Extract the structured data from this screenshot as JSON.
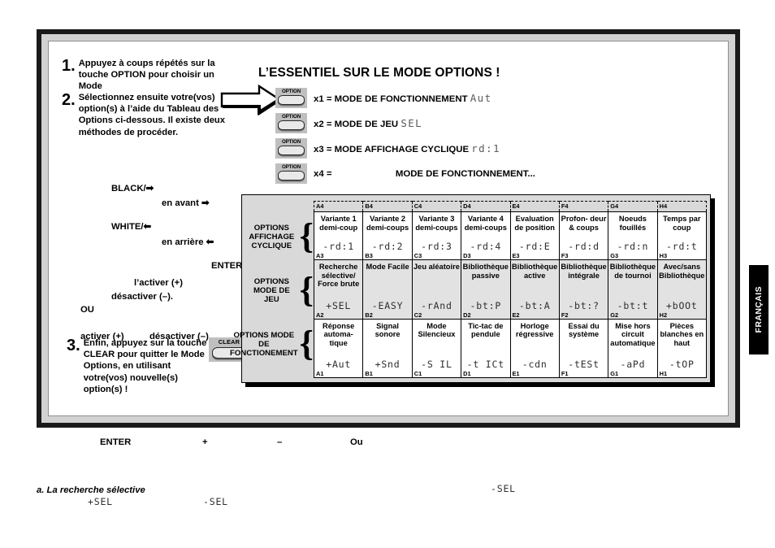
{
  "title": "L’ESSENTIEL SUR LE MODE OPTIONS !",
  "steps": [
    {
      "num": "1.",
      "text": "Appuyez à coups répétés sur la touche OPTION pour choisir un Mode"
    },
    {
      "num": "2.",
      "text": "Sélectionnez ensuite votre(vos) option(s) à l’aide du Tableau des Options ci-dessous. Il existe deux méthodes de procéder."
    },
    {
      "num": "3.",
      "text": "Enfin, appuyez sur la touche CLEAR pour quitter le Mode Options, en utilisant votre(vos) nouvelle(s) option(s) !"
    }
  ],
  "option_rows": [
    {
      "key": "OPTION",
      "count": "x1 =",
      "label": "MODE DE FONCTIONNEMENT",
      "lcd": "Aut"
    },
    {
      "key": "OPTION",
      "count": "x2 =",
      "label": "MODE DE JEU",
      "lcd": "SEL"
    },
    {
      "key": "OPTION",
      "count": "x3 =",
      "label": "MODE AFFICHAGE CYCLIQUE",
      "lcd": "rd:1"
    },
    {
      "key": "OPTION",
      "count": "x4 =",
      "label": "MODE DE FONCTIONNEMENT...",
      "lcd": ""
    }
  ],
  "nav": {
    "black": "BLACK/➡",
    "en_avant": "en avant ➡",
    "white": "WHITE/⬅",
    "en_arriere": "en arrière ⬅",
    "enter": "ENTER",
    "activer": "l’activer (+)",
    "desactiver": "désactiver (–).",
    "ou": "OU",
    "activer2": "activer (+)",
    "desactiver2": "désactiver (–)"
  },
  "clear_key": {
    "label": "CLEAR"
  },
  "table": {
    "groups": [
      "OPTIONS AFFICHAGE CYCLIQUE",
      "OPTIONS MODE DE JEU",
      "OPTIONS MODE DE FONCTIONEMENT"
    ],
    "top_refs": [
      "A4",
      "B4",
      "C4",
      "D4",
      "E4",
      "F4",
      "G4",
      "H4"
    ],
    "rows": [
      {
        "shade": "white",
        "cells": [
          {
            "title": "Variante 1 demi-coup",
            "code": "-rd:1",
            "ref": "A3"
          },
          {
            "title": "Variante 2 demi-coups",
            "code": "-rd:2",
            "ref": "B3"
          },
          {
            "title": "Variante 3 demi-coups",
            "code": "-rd:3",
            "ref": "C3"
          },
          {
            "title": "Variante 4 demi-coups",
            "code": "-rd:4",
            "ref": "D3"
          },
          {
            "title": "Evaluation de position",
            "code": "-rd:E",
            "ref": "E3"
          },
          {
            "title": "Profon- deur & coups",
            "code": "-rd:d",
            "ref": "F3"
          },
          {
            "title": "Noeuds fouillés",
            "code": "-rd:n",
            "ref": "G3"
          },
          {
            "title": "Temps par coup",
            "code": "-rd:t",
            "ref": "H3"
          }
        ]
      },
      {
        "shade": "gray",
        "cells": [
          {
            "title": "Recherche sélective/ Force brute",
            "code": "+SEL",
            "ref": "A2"
          },
          {
            "title": "Mode Facile",
            "code": "-EASY",
            "ref": "B2"
          },
          {
            "title": "Jeu aléatoire",
            "code": "-rAnd",
            "ref": "C2"
          },
          {
            "title": "Bibliothèque passive",
            "code": "-bt:P",
            "ref": "D2"
          },
          {
            "title": "Bibliothèque active",
            "code": "-bt:A",
            "ref": "E2"
          },
          {
            "title": "Bibliothèque intégrale",
            "code": "-bt:?",
            "ref": "F2"
          },
          {
            "title": "Bibliothèque de tournoi",
            "code": "-bt:t",
            "ref": "G2"
          },
          {
            "title": "Avec/sans Bibliothèque",
            "code": "+bOOt",
            "ref": "H2"
          }
        ]
      },
      {
        "shade": "white",
        "cells": [
          {
            "title": "Réponse automa- tique",
            "code": "+Aut",
            "ref": "A1"
          },
          {
            "title": "Signal sonore",
            "code": "+Snd",
            "ref": "B1"
          },
          {
            "title": "Mode Silencieux",
            "code": "-S IL",
            "ref": "C1"
          },
          {
            "title": "Tic-tac de pendule",
            "code": "-t ICt",
            "ref": "D1"
          },
          {
            "title": "Horloge régressive",
            "code": "-cdn",
            "ref": "E1"
          },
          {
            "title": "Essai du système",
            "code": "-tESt",
            "ref": "F1"
          },
          {
            "title": "Mise hors circuit automatique",
            "code": "-aPd",
            "ref": "G1"
          },
          {
            "title": "Pièces blanches en haut",
            "code": "-tOP",
            "ref": "H1"
          }
        ]
      }
    ]
  },
  "bottom": {
    "enter": "ENTER",
    "plus": "+",
    "minus": "–",
    "ou": "Ou"
  },
  "footnote": {
    "label": "a. La recherche sélective",
    "lcd1": "+SEL",
    "lcd2": "-SEL",
    "lcd3": "-SEL"
  },
  "side_tab": {
    "label": "FRANÇAIS"
  },
  "colors": {
    "frame_black": "#1a1a1a",
    "frame_gray": "#d2d2d2",
    "panel_gray": "#d9d9d9",
    "row_gray": "#e2e2e2",
    "key_gray": "#bfbfbf",
    "lcd_gray": "#5b5b5b"
  }
}
